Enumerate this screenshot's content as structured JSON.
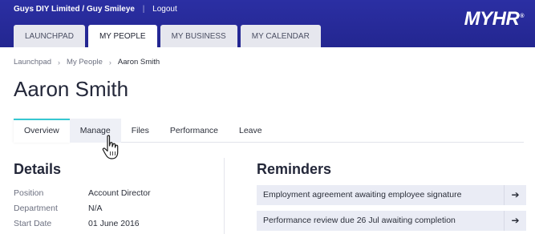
{
  "header": {
    "account": "Guys DIY Limited / Guy Smileye",
    "separator": "|",
    "logout": "Logout",
    "logo": "MYHR",
    "logo_mark": "®"
  },
  "main_tabs": [
    {
      "label": "LAUNCHPAD",
      "active": false
    },
    {
      "label": "MY PEOPLE",
      "active": true
    },
    {
      "label": "MY BUSINESS",
      "active": false
    },
    {
      "label": "MY CALENDAR",
      "active": false
    }
  ],
  "breadcrumb": {
    "items": [
      "Launchpad",
      "My People",
      "Aaron Smith"
    ],
    "separator": "›"
  },
  "page_title": "Aaron Smith",
  "sub_tabs": [
    {
      "label": "Overview",
      "active": true
    },
    {
      "label": "Manage",
      "active": false
    },
    {
      "label": "Files",
      "active": false
    },
    {
      "label": "Performance",
      "active": false
    },
    {
      "label": "Leave",
      "active": false
    }
  ],
  "details": {
    "heading": "Details",
    "rows": [
      {
        "label": "Position",
        "value": "Account Director"
      },
      {
        "label": "Department",
        "value": "N/A"
      },
      {
        "label": "Start Date",
        "value": "01 June 2016"
      }
    ]
  },
  "reminders": {
    "heading": "Reminders",
    "items": [
      {
        "text": "Employment agreement awaiting employee signature",
        "icon": "arrow-right-icon"
      },
      {
        "text": "Performance review due 26 Jul awaiting completion",
        "icon": "arrow-right-icon"
      }
    ]
  },
  "colors": {
    "header_bg": "#2b2fa3",
    "active_tab_accent": "#36c8d2",
    "reminder_bg": "#eaecf5"
  }
}
